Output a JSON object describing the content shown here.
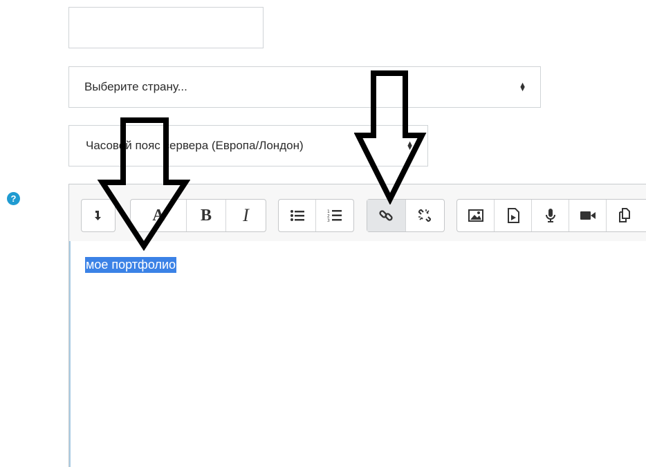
{
  "form": {
    "text_field_value": "",
    "country_select": {
      "selected": "Выберите страну..."
    },
    "timezone_select": {
      "selected": "Часовой пояс сервера (Европа/Лондон)"
    }
  },
  "editor": {
    "help_icon": "question-circle-icon",
    "toolbar_groups": [
      {
        "buttons": [
          {
            "icon": "collapse-toggle-icon"
          }
        ]
      },
      {
        "buttons": [
          {
            "icon": "text-style-icon",
            "glyph": "A"
          },
          {
            "icon": "bold-icon",
            "glyph": "B"
          },
          {
            "icon": "italic-icon",
            "glyph": "I"
          }
        ]
      },
      {
        "buttons": [
          {
            "icon": "unordered-list-icon"
          },
          {
            "icon": "ordered-list-icon"
          }
        ]
      },
      {
        "buttons": [
          {
            "icon": "link-icon"
          },
          {
            "icon": "unlink-icon"
          }
        ]
      },
      {
        "buttons": [
          {
            "icon": "image-icon"
          },
          {
            "icon": "media-icon"
          },
          {
            "icon": "record-audio-icon"
          },
          {
            "icon": "record-video-icon"
          },
          {
            "icon": "manage-files-icon"
          }
        ]
      }
    ],
    "content": "мое портфолио"
  },
  "colors": {
    "accent": "#1f9bd1",
    "selection": "#3b82e6",
    "editor_focus_border": "#8fb6d3"
  },
  "annotations": [
    {
      "icon": "down-arrow-annotation",
      "points_to": "text-style-icon"
    },
    {
      "icon": "down-arrow-annotation",
      "points_to": "link-icon"
    }
  ]
}
